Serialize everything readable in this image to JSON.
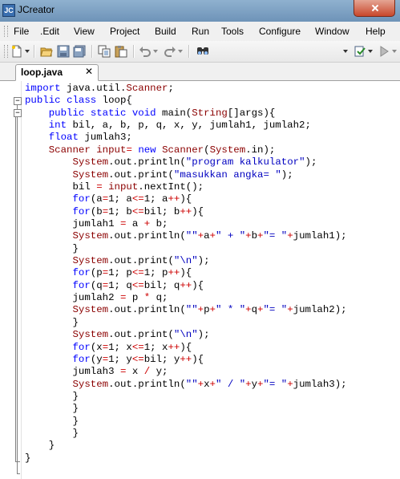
{
  "window": {
    "title": "JCreator",
    "app_icon_glyph": "JC"
  },
  "menu": [
    {
      "label": "File"
    },
    {
      "label": ".Edit"
    },
    {
      "label": "View"
    },
    {
      "label": "Project"
    },
    {
      "label": "Build"
    },
    {
      "label": "Run"
    },
    {
      "label": "Tools"
    },
    {
      "label": "Configure"
    },
    {
      "label": "Window"
    },
    {
      "label": "Help"
    }
  ],
  "toolbar": [
    {
      "icon": "new-file-icon"
    },
    {
      "icon": "open-folder-icon"
    },
    {
      "icon": "save-icon"
    },
    {
      "icon": "save-all-icon"
    },
    {
      "icon": "copy-icon"
    },
    {
      "icon": "paste-icon"
    },
    {
      "icon": "undo-icon"
    },
    {
      "icon": "redo-icon"
    },
    {
      "icon": "find-icon"
    },
    {
      "icon": "build-icon"
    },
    {
      "icon": "run-icon"
    }
  ],
  "tabs": [
    {
      "label": "loop.java",
      "close_glyph": "✕",
      "active": true
    }
  ],
  "code_lines": [
    "import java.util.Scanner;",
    "public class loop{",
    "    public static void main(String[]args){",
    "    int bil, a, b, p, q, x, y, jumlah1, jumlah2;",
    "    float jumlah3;",
    "    Scanner input= new Scanner(System.in);",
    "        System.out.println(\"program kalkulator\");",
    "        System.out.print(\"masukkan angka= \");",
    "        bil = input.nextInt();",
    "        for(a=1; a<=1; a++){",
    "        for(b=1; b<=bil; b++){",
    "        jumlah1 = a + b;",
    "        System.out.println(\"\"+a+\" + \"+b+\"= \"+jumlah1);",
    "        }",
    "        System.out.print(\"\\n\");",
    "        for(p=1; p<=1; p++){",
    "        for(q=1; q<=bil; q++){",
    "        jumlah2 = p * q;",
    "        System.out.println(\"\"+p+\" * \"+q+\"= \"+jumlah2);",
    "        }",
    "        System.out.print(\"\\n\");",
    "        for(x=1; x<=1; x++){",
    "        for(y=1; y<=bil; y++){",
    "        jumlah3 = x / y;",
    "        System.out.println(\"\"+x+\" / \"+y+\"= \"+jumlah3);",
    "        }",
    "        }",
    "        }",
    "        }",
    "    }",
    "}"
  ],
  "fold_markers": {
    "collapse_glyph": "−"
  },
  "colors": {
    "keyword": "#0000ff",
    "string": "#0000c0",
    "operator": "#cc0000",
    "object": "#8b0000",
    "default": "#000000"
  }
}
